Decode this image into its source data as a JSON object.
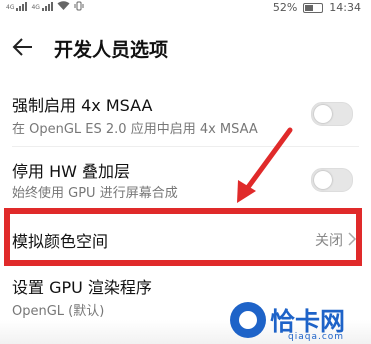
{
  "status_bar": {
    "network_left": "4G",
    "network_right": "4G",
    "battery": "52%",
    "battery_level": 0.52,
    "time": "14:34"
  },
  "header": {
    "title": "开发人员选项",
    "back_icon": "arrow-left-icon"
  },
  "settings": [
    {
      "title": "强制启用 4x MSAA",
      "subtitle": "在 OpenGL ES 2.0 应用中启用 4x MSAA",
      "control": "toggle",
      "on": false
    },
    {
      "title": "停用 HW 叠加层",
      "subtitle": "始终使用 GPU 进行屏幕合成",
      "control": "toggle",
      "on": false
    },
    {
      "title": "模拟颜色空间",
      "value": "关闭",
      "control": "chevron"
    },
    {
      "title": "设置 GPU 渲染程序",
      "subtitle": "OpenGL (默认)",
      "control": "chevron"
    }
  ],
  "annotation": {
    "highlight_color": "#e02a2a"
  },
  "watermark": {
    "text": "恰卡网",
    "sub": "qiaqa.com"
  }
}
